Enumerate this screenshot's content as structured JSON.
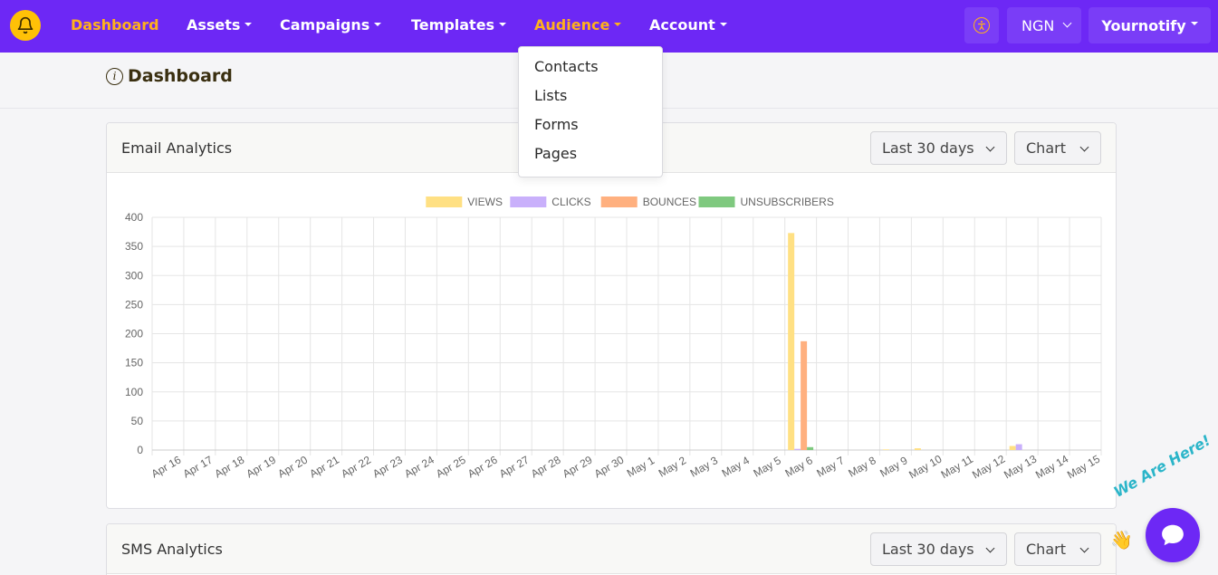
{
  "navbar": {
    "items": [
      {
        "label": "Dashboard",
        "caret": false,
        "active": true
      },
      {
        "label": "Assets",
        "caret": true,
        "active": false
      },
      {
        "label": "Campaigns",
        "caret": true,
        "active": false
      },
      {
        "label": "Templates",
        "caret": true,
        "active": false
      },
      {
        "label": "Audience",
        "caret": true,
        "active": true
      },
      {
        "label": "Account",
        "caret": true,
        "active": false
      }
    ],
    "currency": "NGN",
    "user": "Yournotify",
    "accent_color": "#6d28f5",
    "active_color": "#ffb11c"
  },
  "audience_menu": [
    "Contacts",
    "Lists",
    "Forms",
    "Pages"
  ],
  "page_title": "Dashboard",
  "email_card": {
    "title": "Email Analytics",
    "range_label": "Last 30 days",
    "view_label": "Chart"
  },
  "sms_card": {
    "title": "SMS Analytics",
    "range_label": "Last 30 days",
    "view_label": "Chart"
  },
  "chat": {
    "tagline": "We Are Here!"
  },
  "chart_data": {
    "type": "bar",
    "categories": [
      "Apr 16",
      "Apr 17",
      "Apr 18",
      "Apr 19",
      "Apr 20",
      "Apr 21",
      "Apr 22",
      "Apr 23",
      "Apr 24",
      "Apr 25",
      "Apr 26",
      "Apr 27",
      "Apr 28",
      "Apr 29",
      "Apr 30",
      "May 1",
      "May 2",
      "May 3",
      "May 4",
      "May 5",
      "May 6",
      "May 7",
      "May 8",
      "May 9",
      "May 10",
      "May 11",
      "May 12",
      "May 13",
      "May 14",
      "May 15"
    ],
    "series": [
      {
        "name": "VIEWS",
        "color": "#ffe083",
        "values": [
          0,
          0,
          0,
          0,
          0,
          0,
          0,
          0,
          0,
          0,
          0,
          0,
          0,
          0,
          0,
          0,
          0,
          0,
          0,
          0,
          373,
          0,
          0,
          1,
          3,
          0,
          0,
          7,
          0,
          0
        ]
      },
      {
        "name": "CLICKS",
        "color": "#c9b0fb",
        "values": [
          0,
          0,
          0,
          0,
          0,
          0,
          0,
          0,
          0,
          0,
          0,
          0,
          0,
          0,
          0,
          0,
          0,
          0,
          0,
          0,
          2,
          0,
          0,
          0,
          0,
          0,
          0,
          10,
          0,
          0
        ]
      },
      {
        "name": "BOUNCES",
        "color": "#ffb07f",
        "values": [
          0,
          0,
          0,
          0,
          0,
          0,
          0,
          0,
          0,
          0,
          0,
          0,
          0,
          0,
          0,
          0,
          0,
          0,
          0,
          0,
          187,
          0,
          0,
          0,
          0,
          0,
          0,
          0,
          0,
          0
        ]
      },
      {
        "name": "UNSUBSCRIBERS",
        "color": "#7fc97f",
        "values": [
          0,
          0,
          0,
          0,
          0,
          0,
          0,
          0,
          0,
          0,
          0,
          0,
          0,
          0,
          0,
          0,
          0,
          0,
          0,
          0,
          5,
          0,
          0,
          0,
          0,
          0,
          0,
          0,
          0,
          0
        ]
      }
    ],
    "yticks": [
      "0",
      "50",
      "100",
      "150",
      "200",
      "250",
      "300",
      "350",
      "400"
    ],
    "ylim": [
      0,
      400
    ],
    "legend": "top-center",
    "grid": true
  }
}
